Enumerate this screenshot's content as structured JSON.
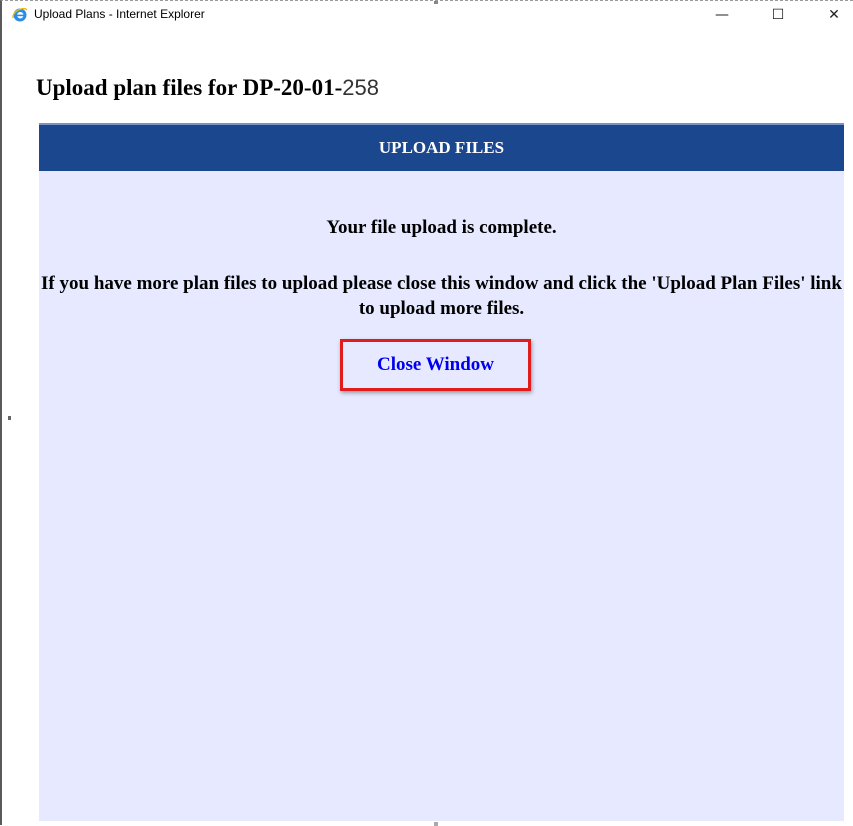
{
  "window": {
    "title": "Upload Plans - Internet Explorer",
    "icon": "internet-explorer-icon",
    "controls": {
      "minimize_glyph": "—",
      "maximize_glyph": "☐",
      "close_glyph": "✕"
    }
  },
  "page": {
    "heading": "Upload plan files for DP-20-01-",
    "heading_suffix": "258"
  },
  "panel": {
    "header": "UPLOAD FILES",
    "message_complete": "Your file upload is complete.",
    "message_more": "If you have more plan files to upload please close this window and click the 'Upload Plan Files' link to upload more files.",
    "close_link": "Close Window"
  },
  "colors": {
    "header_bg": "#1b478f",
    "panel_bg": "#e6e9ff",
    "link": "#0000ee",
    "highlight_border": "#e11c1c"
  }
}
